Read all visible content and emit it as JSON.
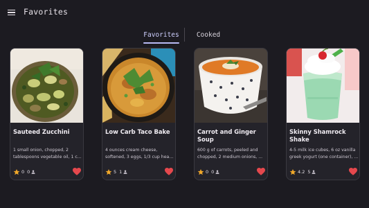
{
  "app": {
    "title": "Favorites",
    "menu_icon": "menu-icon"
  },
  "tabs": [
    {
      "label": "Favorites",
      "selected": true
    },
    {
      "label": "Cooked",
      "selected": false
    }
  ],
  "colors": {
    "accent": "#b9baf5",
    "star": "#f0a82a",
    "heart": "#e5484d",
    "background": "#1c1b21",
    "card": "#24232a"
  },
  "recipes": [
    {
      "title": "Sauteed Zucchini",
      "desc_line1": "1 small onion, chopped, 2",
      "desc_line2": "tablespoons vegetable oil, 1 c...",
      "rating": "0",
      "cooked": "0",
      "favorite": true
    },
    {
      "title": "Low Carb Taco Bake",
      "desc_line1": "4 ounces cream cheese,",
      "desc_line2": "softened, 3 eggs, 1/3 cup heav...",
      "rating": "5",
      "cooked": "1",
      "favorite": true
    },
    {
      "title": "Carrot and Ginger Soup",
      "desc_line1": "600 g of carrots, peeled and",
      "desc_line2": "chopped, 2 medium onions, ...",
      "rating": "0",
      "cooked": "0",
      "favorite": true
    },
    {
      "title": "Skinny Shamrock Shake",
      "desc_line1": "4-5 milk ice cubes, 6 oz vanilla",
      "desc_line2": "greek yogurt (one container), ...",
      "rating": "4.2",
      "cooked": "5",
      "favorite": true
    }
  ]
}
